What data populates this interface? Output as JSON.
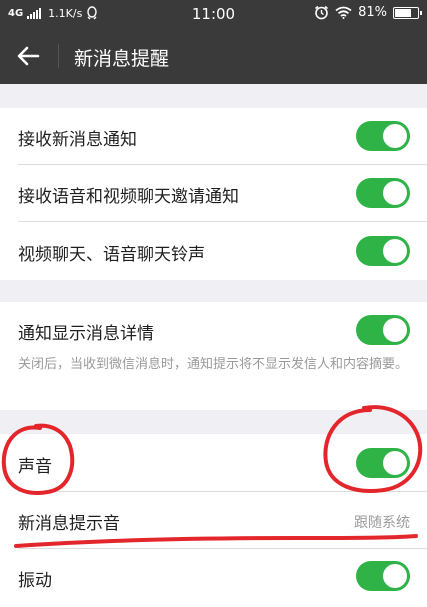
{
  "status_bar": {
    "network": "4G",
    "speed": "1.1K/s",
    "time": "11:00",
    "battery_text": "81%",
    "battery_level": 0.81
  },
  "toolbar": {
    "title": "新消息提醒"
  },
  "settings": {
    "receive_new_message": {
      "label": "接收新消息通知",
      "enabled": true
    },
    "receive_call_invite": {
      "label": "接收语音和视频聊天邀请通知",
      "enabled": true
    },
    "call_ringtone": {
      "label": "视频聊天、语音聊天铃声",
      "enabled": true
    },
    "show_details": {
      "label": "通知显示消息详情",
      "enabled": true,
      "description": "关闭后，当收到微信消息时，通知提示将不显示发信人和内容摘要。"
    },
    "sound": {
      "label": "声音",
      "enabled": true
    },
    "notification_tone": {
      "label": "新消息提示音",
      "value": "跟随系统"
    },
    "vibrate": {
      "label": "振动",
      "enabled": true
    }
  },
  "colors": {
    "toggle_on": "#2fb346",
    "annotation_red": "#e3262b",
    "header_bg": "#3a3a3a"
  }
}
